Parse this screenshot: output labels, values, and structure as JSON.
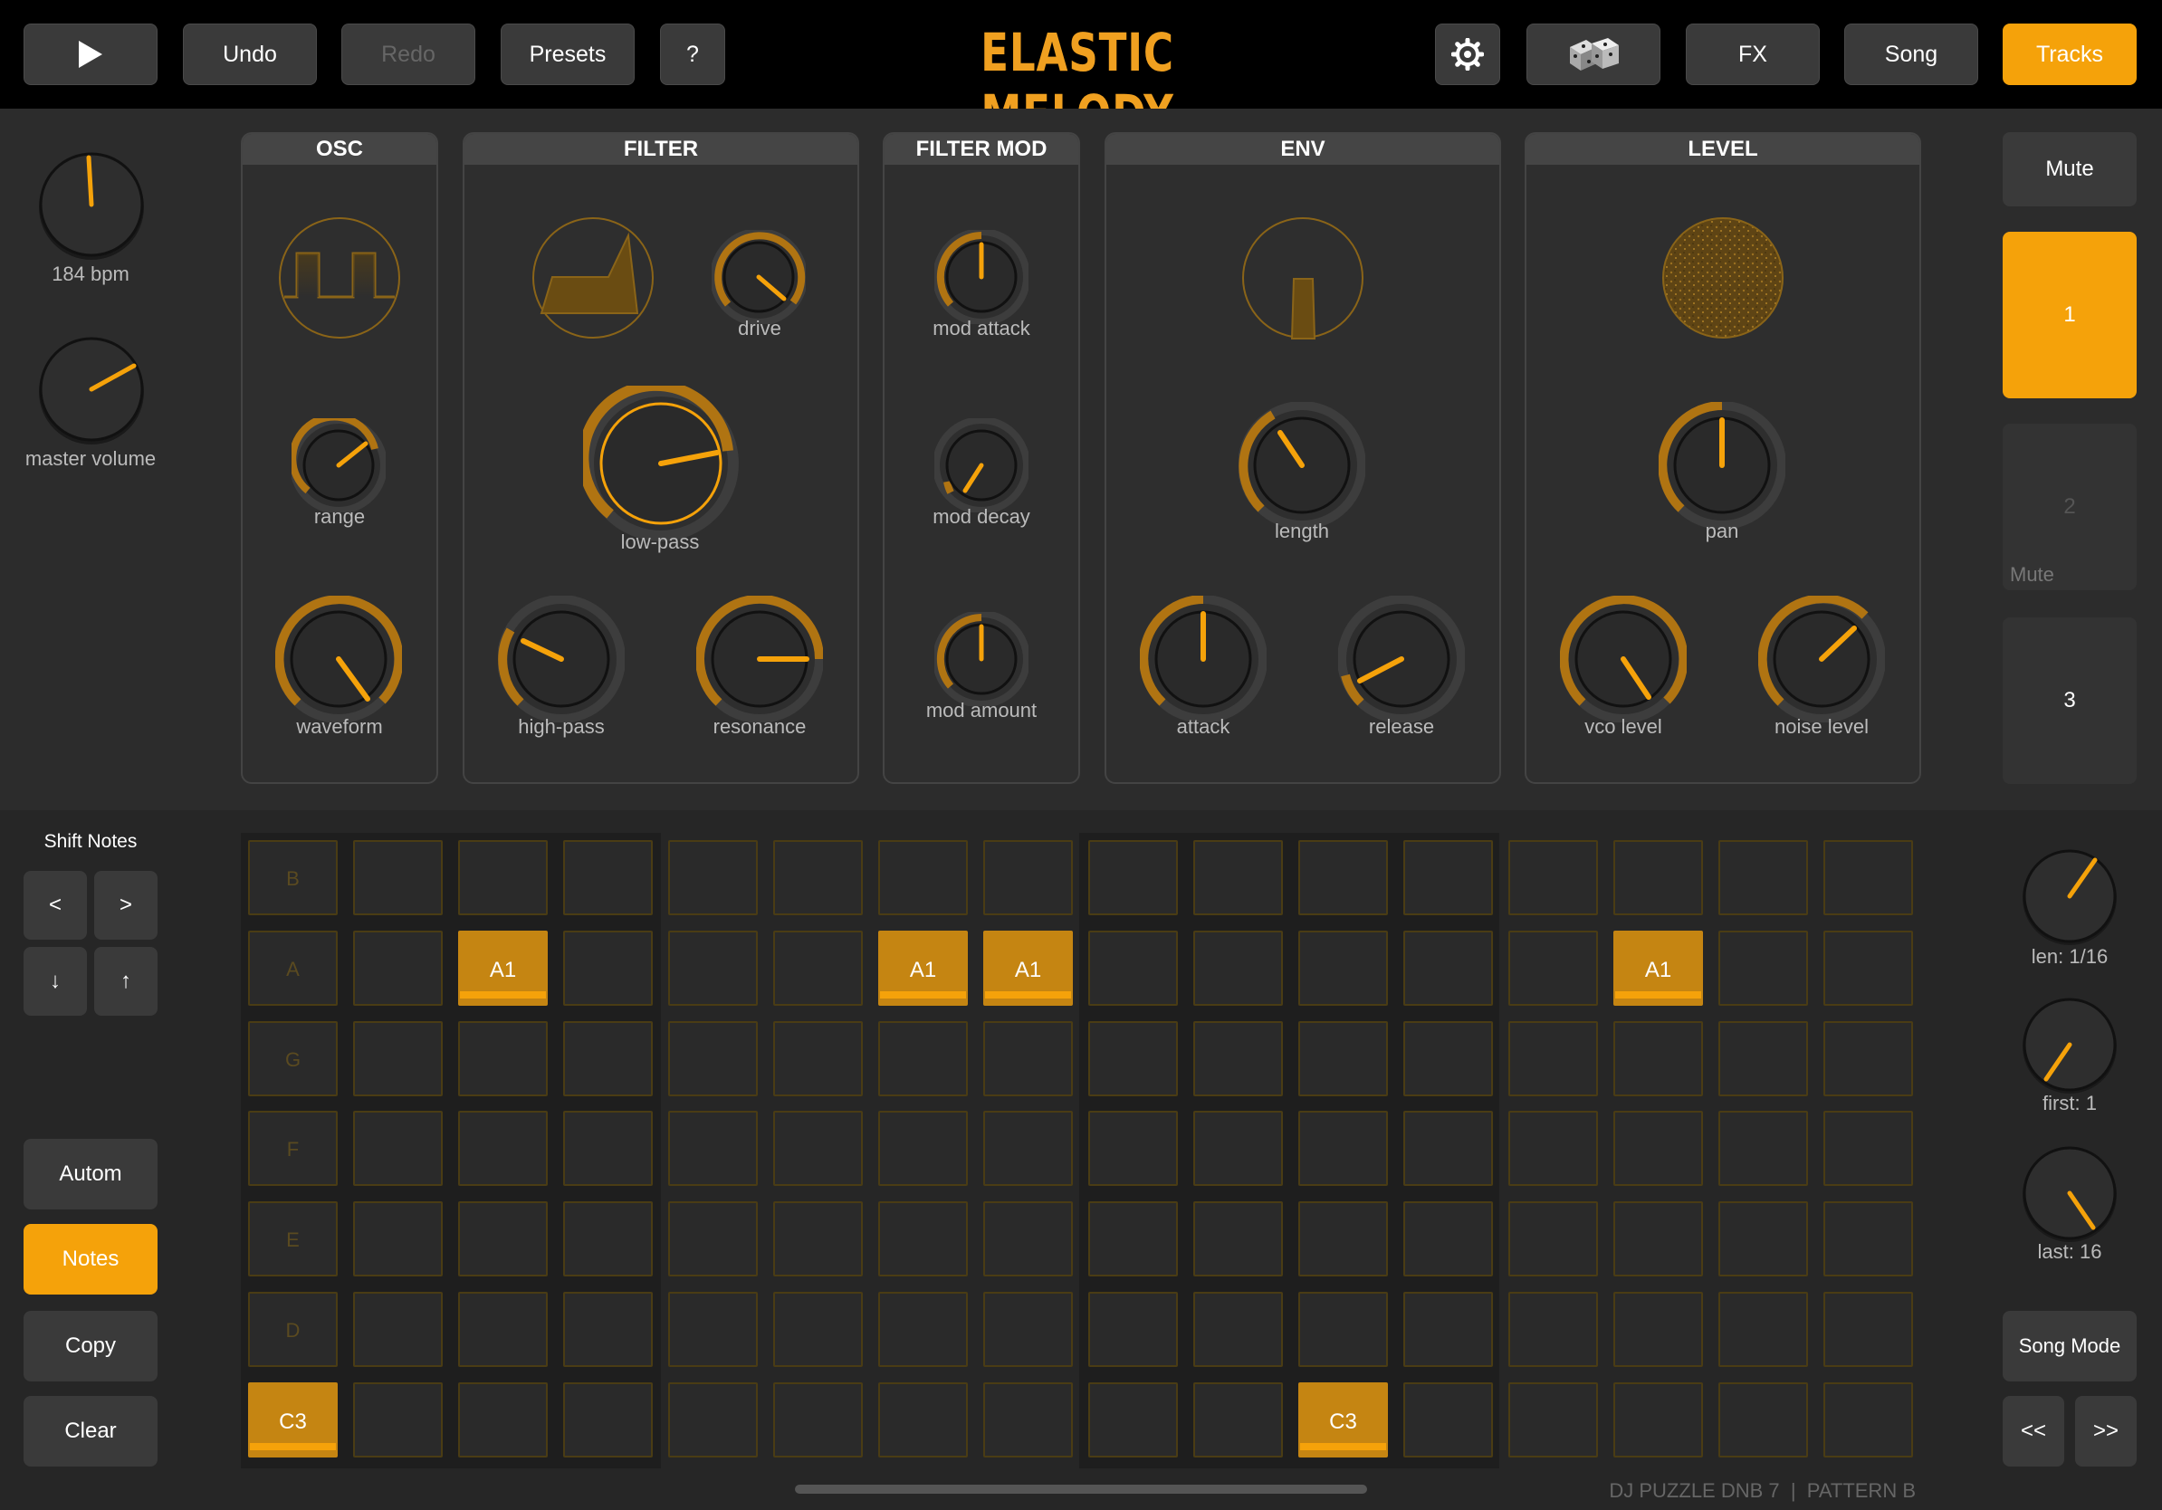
{
  "app_title": "ELASTIC MELODY",
  "toolbar": {
    "play_icon": "play-icon",
    "undo": "Undo",
    "redo": "Redo",
    "presets": "Presets",
    "help": "?",
    "settings_icon": "gear-icon",
    "dice_icon": "dice-icon",
    "fx": "FX",
    "song": "Song",
    "tracks": "Tracks"
  },
  "global": {
    "tempo_label": "184 bpm",
    "master_volume_label": "master volume"
  },
  "sections": {
    "osc": "OSC",
    "filter": "FILTER",
    "filter_mod": "FILTER MOD",
    "env": "ENV",
    "level": "LEVEL"
  },
  "knobs": {
    "range": "range",
    "waveform": "waveform",
    "drive": "drive",
    "low_pass": "low-pass",
    "high_pass": "high-pass",
    "resonance": "resonance",
    "mod_attack": "mod attack",
    "mod_decay": "mod decay",
    "mod_amount": "mod amount",
    "length": "length",
    "attack": "attack",
    "release": "release",
    "pan": "pan",
    "vco_level": "vco level",
    "noise_level": "noise level"
  },
  "tracks": {
    "mute": "Mute",
    "track1": "1",
    "track2": "2",
    "track2_mute": "Mute",
    "track3": "3"
  },
  "shift_notes": {
    "title": "Shift Notes",
    "left": "<",
    "right": ">",
    "down": "↓",
    "up": "↑"
  },
  "mode_buttons": {
    "autom": "Autom",
    "notes": "Notes",
    "copy": "Copy",
    "clear": "Clear"
  },
  "pattern_controls": {
    "len": "len: 1/16",
    "first": "first: 1",
    "last": "last: 16",
    "song_mode": "Song Mode",
    "prev": "<<",
    "next": ">>"
  },
  "footer": "DJ PUZZLE DNB 7  |  PATTERN B",
  "grid": {
    "row_labels": [
      "B",
      "A",
      "G",
      "F",
      "E",
      "D",
      "C"
    ],
    "notes": [
      {
        "row": 1,
        "col": 2,
        "label": "A1"
      },
      {
        "row": 1,
        "col": 6,
        "label": "A1"
      },
      {
        "row": 1,
        "col": 7,
        "label": "A1"
      },
      {
        "row": 1,
        "col": 13,
        "label": "A1"
      },
      {
        "row": 6,
        "col": 0,
        "label": "C3"
      },
      {
        "row": 6,
        "col": 10,
        "label": "C3"
      }
    ]
  },
  "colors": {
    "accent": "#f5a20a",
    "background": "#2a2a2a"
  }
}
